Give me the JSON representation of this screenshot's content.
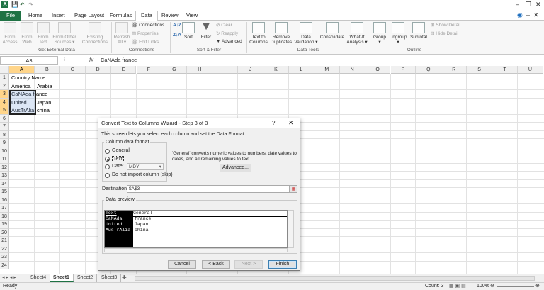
{
  "titlebar": {
    "quick_save": "💾",
    "undo": "↶",
    "redo": "↷"
  },
  "tabs": [
    "File",
    "Home",
    "Insert",
    "Page Layout",
    "Formulas",
    "Data",
    "Review",
    "View"
  ],
  "ribbon": {
    "get_external": {
      "from_access": "From Access",
      "from_web": "From Web",
      "from_text": "From Text",
      "from_other": "From Other Sources ▾",
      "existing": "Existing Connections",
      "group": "Get External Data"
    },
    "connections": {
      "refresh": "Refresh All ▾",
      "connections": "Connections",
      "properties": "Properties",
      "edit_links": "Edit Links",
      "group": "Connections"
    },
    "sort_filter": {
      "sort": "Sort",
      "filter": "Filter",
      "clear": "Clear",
      "reapply": "Reapply",
      "advanced": "Advanced",
      "group": "Sort & Filter"
    },
    "data_tools": {
      "text_to_columns": "Text to Columns",
      "remove_dup": "Remove Duplicates",
      "validation": "Data Validation ▾",
      "consolidate": "Consolidate",
      "whatif": "What-If Analysis ▾",
      "group": "Data Tools"
    },
    "outline": {
      "group_btn": "Group ▾",
      "ungroup": "Ungroup ▾",
      "subtotal": "Subtotal",
      "show_detail": "Show Detail",
      "hide_detail": "Hide Detail",
      "group": "Outline"
    }
  },
  "formula_bar": {
    "name_box": "A3",
    "fx": "fx",
    "value": "CaNAda france"
  },
  "columns": [
    "A",
    "B",
    "C",
    "D",
    "E",
    "F",
    "G",
    "H",
    "I",
    "J",
    "K",
    "L",
    "M",
    "N",
    "O",
    "P",
    "Q",
    "R",
    "S",
    "T",
    "U"
  ],
  "rows": [
    "1",
    "2",
    "3",
    "4",
    "5",
    "6",
    "7",
    "8",
    "9",
    "10",
    "11",
    "12",
    "13",
    "14",
    "15",
    "16",
    "17",
    "18",
    "19",
    "20",
    "21",
    "22",
    "23",
    "24"
  ],
  "cells": {
    "r1": "Country Name",
    "r2a": "America",
    "r2b": "Arabia",
    "r3": "CaNAda france",
    "r4a": "United",
    "r4b": "Japan",
    "r5a": "AusTrAlia",
    "r5b": "china"
  },
  "dialog": {
    "title": "Convert Text to Columns Wizard - Step 3 of 3",
    "help": "?",
    "close": "✕",
    "intro": "This screen lets you select each column and set the Data Format.",
    "format_legend": "Column data format",
    "opt_general": "General",
    "opt_text": "Text",
    "opt_date": "Date:",
    "date_value": "MDY",
    "opt_skip": "Do not import column (skip)",
    "general_note": "'General' converts numeric values to numbers, date values to dates, and all remaining values to text.",
    "advanced": "Advanced...",
    "destination_label": "Destination:",
    "destination_value": "$A$3",
    "preview_legend": "Data preview",
    "preview_head": [
      "Text",
      "General"
    ],
    "preview_col1": [
      "CaNAda",
      "United",
      "AusTrAlia"
    ],
    "preview_col2": [
      "france",
      "Japan",
      "china"
    ],
    "cancel": "Cancel",
    "back": "< Back",
    "next": "Next >",
    "finish": "Finish"
  },
  "sheets": [
    "Sheet4",
    "Sheet1",
    "Sheet2",
    "Sheet3"
  ],
  "status": {
    "ready": "Ready",
    "count": "Count: 3",
    "zoom": "100%"
  },
  "colors": {
    "excel_green": "#1f7244",
    "selection": "#ffd58a"
  }
}
